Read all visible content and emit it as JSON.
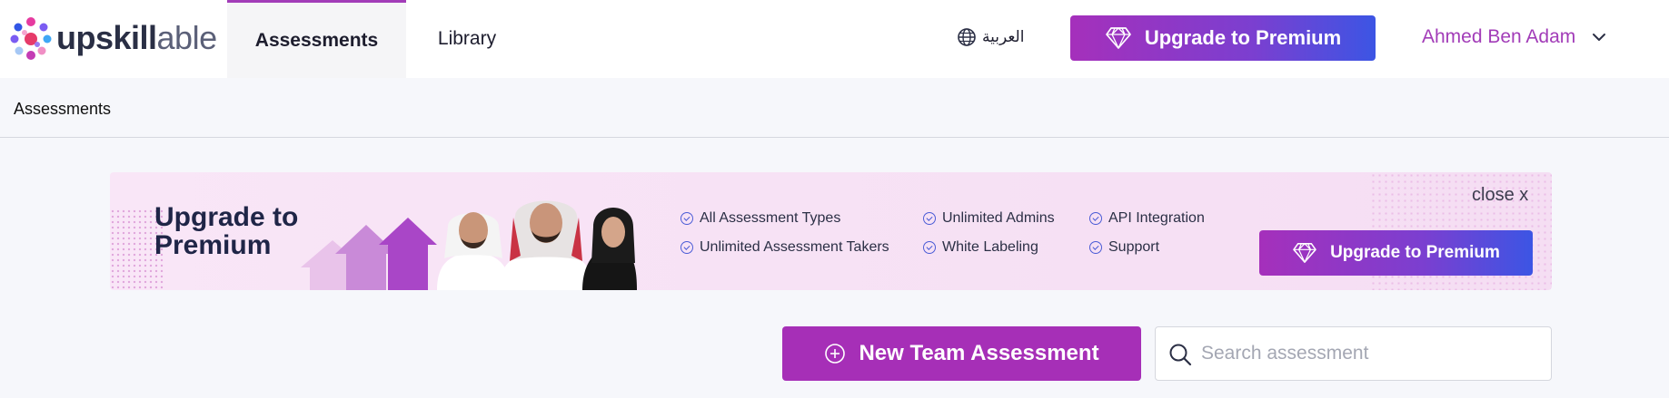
{
  "brand": {
    "logo_text_a": "upskill",
    "logo_text_b": "able"
  },
  "nav": {
    "tabs": [
      {
        "label": "Assessments",
        "active": true
      },
      {
        "label": "Library",
        "active": false
      }
    ],
    "language_label": "العربية",
    "upgrade_label": "Upgrade to Premium",
    "user_name": "Ahmed Ben Adam"
  },
  "breadcrumb": {
    "label": "Assessments"
  },
  "banner": {
    "title_line1": "Upgrade to",
    "title_line2": "Premium",
    "features": [
      [
        "All Assessment Types",
        "Unlimited Assessment Takers"
      ],
      [
        "Unlimited Admins",
        "White Labeling"
      ],
      [
        "API Integration",
        "Support"
      ]
    ],
    "close_label": "close x",
    "upgrade_label": "Upgrade to Premium"
  },
  "actions": {
    "new_team_label": "New Team Assessment",
    "search_placeholder": "Search assessment"
  },
  "colors": {
    "accent_purple": "#a62fb7",
    "gradient_start": "#a530bb",
    "gradient_end": "#3c55e4",
    "user_color": "#a23cb8"
  },
  "icons": {
    "language": "globe-icon",
    "upgrade": "diamond-icon",
    "user_menu": "chevron-down-icon",
    "feature": "check-circle-icon",
    "new": "plus-circle-icon",
    "search": "search-icon"
  }
}
